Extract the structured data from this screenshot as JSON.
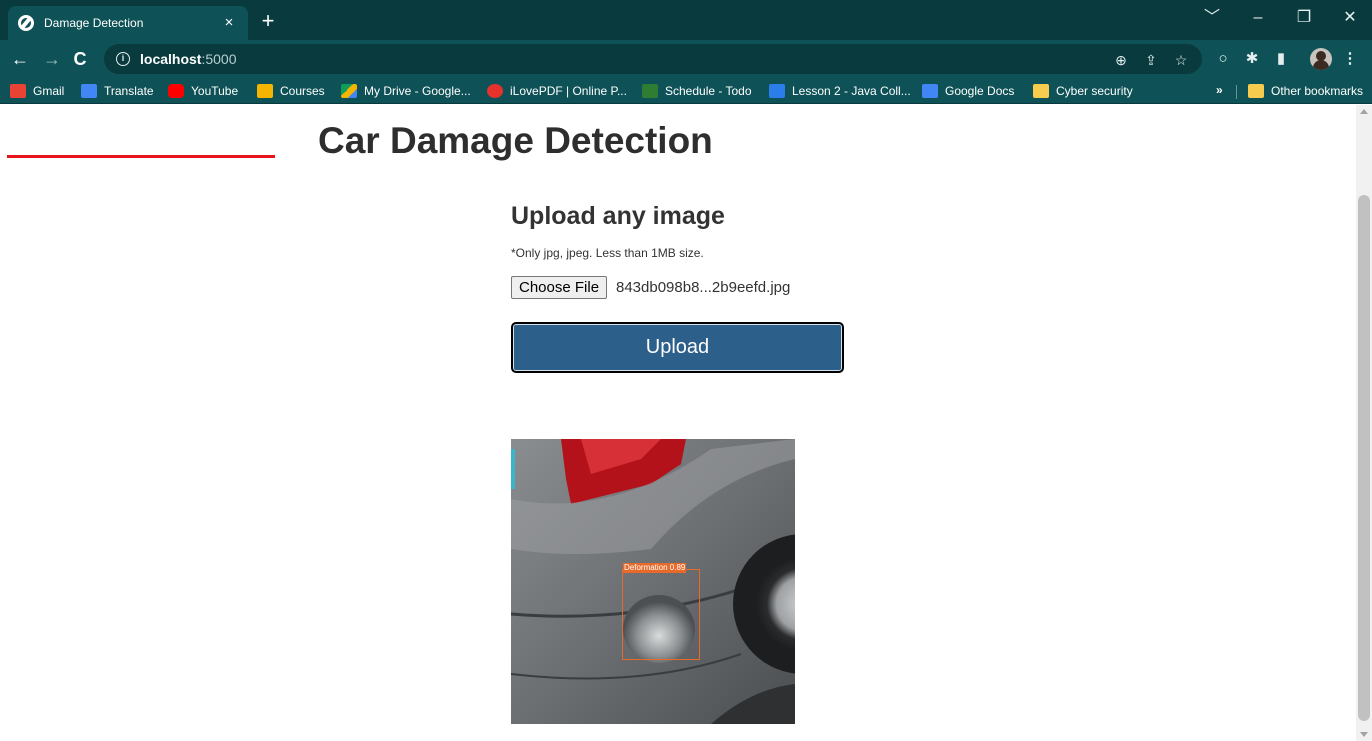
{
  "browser": {
    "tab_title": "Damage Detection",
    "tab_close": "×",
    "new_tab": "+",
    "url_host": "localhost",
    "url_rest": ":5000",
    "window_controls": [
      "﹀",
      "–",
      "❐",
      "✕"
    ]
  },
  "bookmarks": {
    "items": [
      {
        "label": "Gmail",
        "icon": "gmail-icon",
        "color": "#ea4335"
      },
      {
        "label": "Translate",
        "icon": "translate-icon",
        "color": "#4285f4"
      },
      {
        "label": "YouTube",
        "icon": "youtube-icon",
        "color": "#ff0000"
      },
      {
        "label": "Courses",
        "icon": "courses-icon",
        "color": "#f4b400"
      },
      {
        "label": "My Drive - Google...",
        "icon": "drive-icon",
        "color": "#0f9d58"
      },
      {
        "label": "iLovePDF | Online P...",
        "icon": "ilovepdf-icon",
        "color": "#e5322d"
      },
      {
        "label": "Schedule - Todo",
        "icon": "todo-icon",
        "color": "#2e7d32"
      },
      {
        "label": "Lesson 2 - Java Coll...",
        "icon": "laptop-icon",
        "color": "#2b7de9"
      },
      {
        "label": "Google Docs",
        "icon": "docs-icon",
        "color": "#4285f4"
      },
      {
        "label": "Cyber security",
        "icon": "folder-icon",
        "color": "#f7cb4d"
      }
    ],
    "more": "»",
    "other": "Other bookmarks",
    "other_color": "#f7cb4d"
  },
  "page": {
    "title": "Car Damage Detection",
    "upload_heading": "Upload any image",
    "upload_note": "*Only jpg, jpeg. Less than 1MB size.",
    "choose_file_label": "Choose File",
    "file_name": "843db098b8...2b9eefd.jpg",
    "upload_button": "Upload",
    "detection_label": "Deformation 0.89",
    "accent_red": "#e8141b",
    "button_color": "#2c5f8a"
  }
}
